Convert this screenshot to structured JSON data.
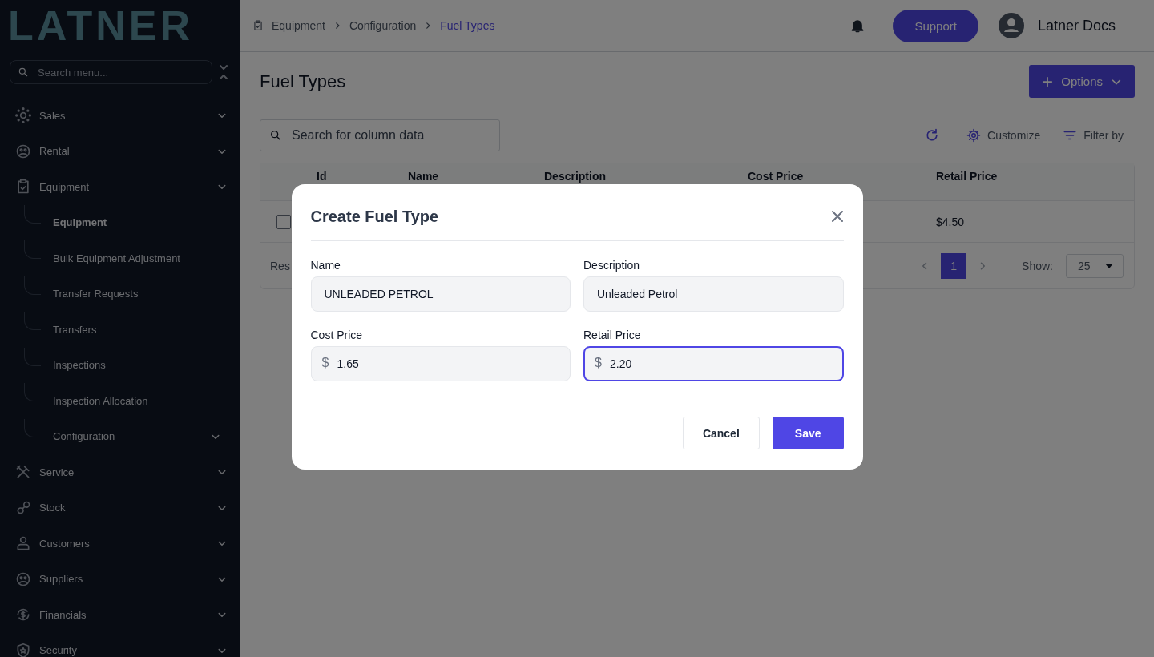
{
  "sidebar": {
    "logo": "LATNER",
    "search": {
      "placeholder": "Search menu..."
    },
    "items": [
      {
        "kind": "sales",
        "label": "Sales"
      },
      {
        "kind": "rental",
        "label": "Rental"
      },
      {
        "kind": "equipment",
        "label": "Equipment",
        "children": [
          {
            "label": "Equipment",
            "selected": true,
            "expandable": false
          },
          {
            "label": "Bulk Equipment Adjustment",
            "selected": false,
            "expandable": false
          },
          {
            "label": "Transfer Requests",
            "selected": false,
            "expandable": false
          },
          {
            "label": "Transfers",
            "selected": false,
            "expandable": false
          },
          {
            "label": "Inspections",
            "selected": false,
            "expandable": false
          },
          {
            "label": "Inspection Allocation",
            "selected": false,
            "expandable": false
          },
          {
            "label": "Configuration",
            "selected": false,
            "expandable": true
          }
        ]
      },
      {
        "kind": "service",
        "label": "Service"
      },
      {
        "kind": "stock",
        "label": "Stock"
      },
      {
        "kind": "customers",
        "label": "Customers"
      },
      {
        "kind": "suppliers",
        "label": "Suppliers"
      },
      {
        "kind": "financials",
        "label": "Financials"
      },
      {
        "kind": "security",
        "label": "Security"
      }
    ]
  },
  "header": {
    "breadcrumbs": [
      {
        "label": "Equipment",
        "current": false
      },
      {
        "label": "Configuration",
        "current": false
      },
      {
        "label": "Fuel Types",
        "current": true
      }
    ],
    "support_button": "Support",
    "user_name": "Latner Docs"
  },
  "page": {
    "title": "Fuel Types",
    "options_button": "Options",
    "search": {
      "placeholder": "Search for column data"
    },
    "toolbar": {
      "customize": "Customize",
      "filter": "Filter by"
    },
    "table": {
      "columns": [
        "Id",
        "Name",
        "Description",
        "Cost Price",
        "Retail Price"
      ],
      "rows": [
        {
          "checked": false,
          "retail_price": "$4.50"
        }
      ],
      "footer": {
        "results_text": "Res",
        "pages": [
          {
            "label": "1",
            "selected": true
          }
        ],
        "show_label": "Show:",
        "page_size": "25"
      }
    }
  },
  "dialog": {
    "title": "Create Fuel Type",
    "fields": [
      {
        "label": "Name",
        "value": "UNLEADED PETROL",
        "focused": false
      },
      {
        "label": "Description",
        "value": "Unleaded Petrol",
        "focused": false
      },
      {
        "label": "Cost Price",
        "prefix": "$",
        "value": "1.65",
        "focused": false
      },
      {
        "label": "Retail Price",
        "prefix": "$",
        "value": "2.20",
        "focused": true
      }
    ],
    "buttons": [
      {
        "label": "Cancel",
        "kind": "secondary"
      },
      {
        "label": "Save",
        "kind": "primary"
      }
    ]
  }
}
